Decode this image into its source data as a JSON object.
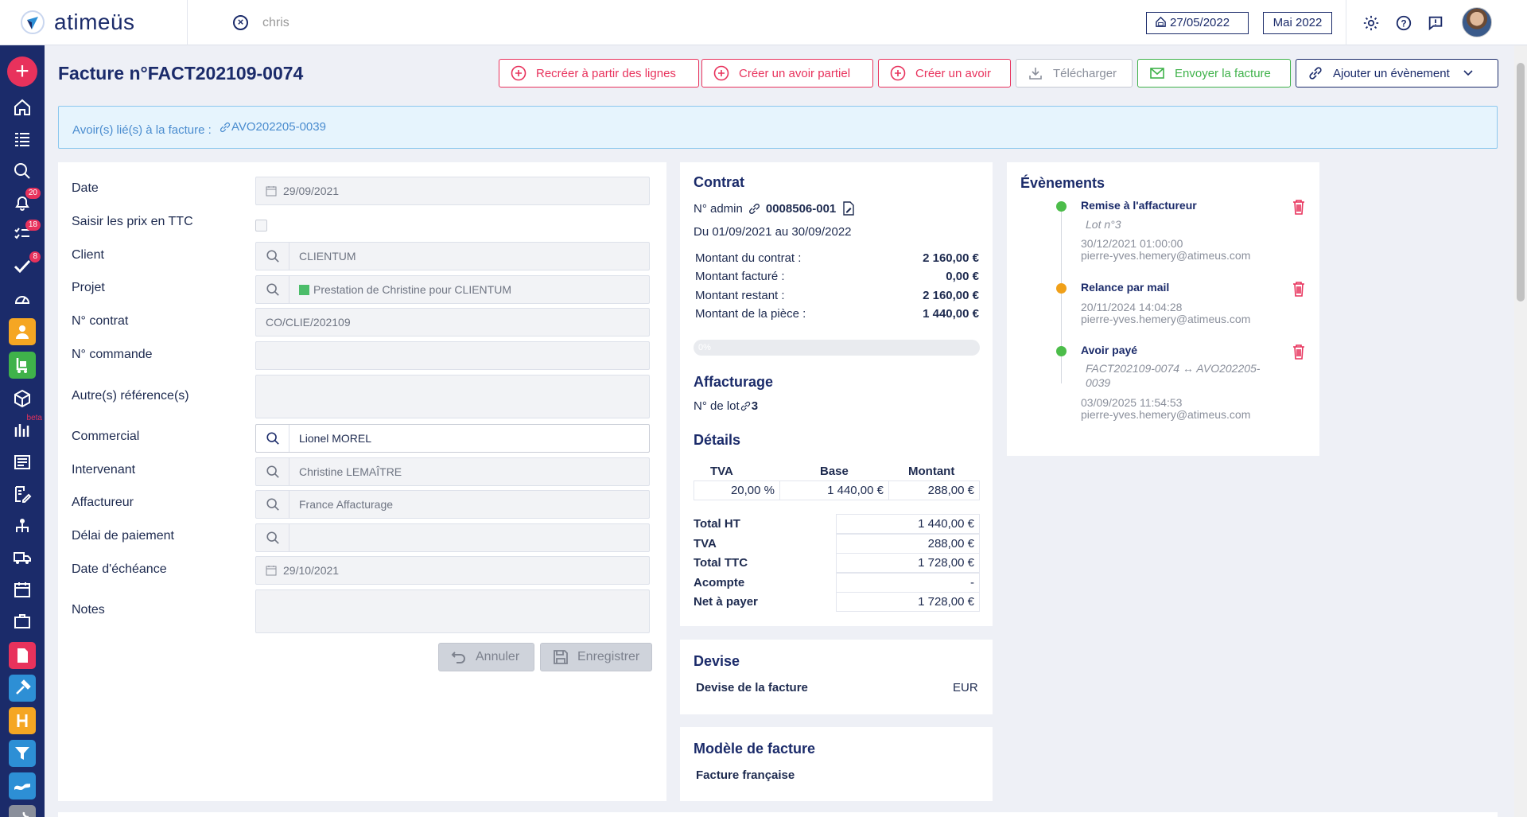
{
  "app": {
    "name": "atimeüs"
  },
  "topbar": {
    "search_value": "chris",
    "date": "27/05/2022",
    "period": "Mai 2022"
  },
  "sidebar": {
    "badges": {
      "notifications": "20",
      "tasks": "18",
      "validations": "8"
    },
    "beta_label": "beta"
  },
  "page": {
    "title": "Facture n°FACT202109-0074",
    "actions": {
      "recreate": "Recréer à partir des lignes",
      "partial_credit": "Créer un avoir partiel",
      "credit": "Créer un avoir",
      "download": "Télécharger",
      "send": "Envoyer la facture",
      "add_event": "Ajouter un évènement"
    },
    "alert": {
      "label": "Avoir(s) lié(s) à la facture :",
      "link": "AVO202205-0039"
    }
  },
  "form": {
    "date": {
      "label": "Date",
      "value": "29/09/2021"
    },
    "ttc": {
      "label": "Saisir les prix en TTC"
    },
    "client": {
      "label": "Client",
      "value": "CLIENTUM"
    },
    "projet": {
      "label": "Projet",
      "value": "Prestation de Christine pour CLIENTUM"
    },
    "contrat": {
      "label": "N° contrat",
      "value": "CO/CLIE/202109"
    },
    "commande": {
      "label": "N° commande",
      "value": ""
    },
    "references": {
      "label": "Autre(s) référence(s)"
    },
    "commercial": {
      "label": "Commercial",
      "value": "Lionel MOREL"
    },
    "intervenant": {
      "label": "Intervenant",
      "value": "Christine LEMAÎTRE"
    },
    "affactureur": {
      "label": "Affactureur",
      "value": "France Affacturage"
    },
    "delai": {
      "label": "Délai de paiement",
      "value": ""
    },
    "echeance": {
      "label": "Date d'échéance",
      "value": "29/10/2021"
    },
    "notes": {
      "label": "Notes"
    },
    "cancel": "Annuler",
    "save": "Enregistrer"
  },
  "contract": {
    "title": "Contrat",
    "admin_label": "N° admin",
    "number": "0008506-001",
    "period": "Du 01/09/2021 au 30/09/2022",
    "amounts": [
      {
        "label": "Montant du contrat :",
        "value": "2 160,00 €"
      },
      {
        "label": "Montant facturé :",
        "value": "0,00 €"
      },
      {
        "label": "Montant restant :",
        "value": "2 160,00 €"
      },
      {
        "label": "Montant de la pièce :",
        "value": "1 440,00 €"
      }
    ],
    "progress_pct": 0,
    "progress_label": "0%",
    "affacturage_title": "Affacturage",
    "lot_label": "N° de lot",
    "lot_value": "3",
    "details_title": "Détails",
    "tva_headers": {
      "tva": "TVA",
      "base": "Base",
      "montant": "Montant"
    },
    "tva_row": {
      "tva": "20,00 %",
      "base": "1 440,00 €",
      "montant": "288,00 €"
    },
    "totals": [
      {
        "label": "Total HT",
        "value": "1 440,00 €"
      },
      {
        "label": "TVA",
        "value": "288,00 €"
      },
      {
        "label": "Total TTC",
        "value": "1 728,00 €"
      },
      {
        "label": "Acompte",
        "value": "-"
      },
      {
        "label": "Net à payer",
        "value": "1 728,00 €"
      }
    ]
  },
  "devise": {
    "title": "Devise",
    "label": "Devise de la facture",
    "value": "EUR"
  },
  "modele": {
    "title": "Modèle de facture",
    "value": "Facture française"
  },
  "events": {
    "title": "Évènements",
    "items": [
      {
        "title": "Remise à l'affactureur",
        "sub": "Lot n°3",
        "date": "30/12/2021 01:00:00",
        "user": "pierre-yves.hemery@atimeus.com",
        "color": "#4cbd4a"
      },
      {
        "title": "Relance par mail",
        "sub": "",
        "date": "20/11/2024 14:04:28",
        "user": "pierre-yves.hemery@atimeus.com",
        "color": "#f0a019"
      },
      {
        "title": "Avoir payé",
        "sub": "FACT202109-0074 ↔ AVO202205-0039",
        "date": "03/09/2025 11:54:53",
        "user": "pierre-yves.hemery@atimeus.com",
        "color": "#4cbd4a"
      }
    ]
  },
  "colors": {
    "navy": "#1b2b6a",
    "red": "#e8325c",
    "green": "#3fb24a"
  }
}
